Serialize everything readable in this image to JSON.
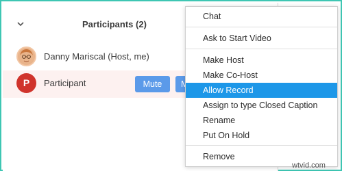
{
  "panel": {
    "title": "Participants (2)",
    "participants": [
      {
        "name": "Danny Mariscal (Host, me)"
      },
      {
        "name": "Participant",
        "initial": "P",
        "mute_label": "Mute",
        "more_label": "M"
      }
    ]
  },
  "menu": {
    "items": [
      {
        "label": "Chat"
      },
      {
        "label": "Ask to Start Video"
      },
      {
        "label": "Make Host"
      },
      {
        "label": "Make Co-Host"
      },
      {
        "label": "Allow Record"
      },
      {
        "label": "Assign to type Closed Caption"
      },
      {
        "label": "Rename"
      },
      {
        "label": "Put On Hold"
      },
      {
        "label": "Remove"
      }
    ],
    "highlighted": "Allow Record"
  },
  "watermark": "wtvid.com",
  "colors": {
    "frame": "#3ec6b3",
    "accent_button": "#5b9ae9",
    "menu_highlight": "#1d97e8",
    "avatar_red": "#d0342c",
    "row_highlight": "#fdf1f0"
  },
  "icons": {
    "collapse": "chevron-down-icon"
  }
}
